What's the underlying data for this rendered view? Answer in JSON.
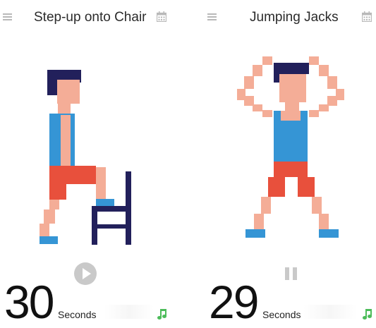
{
  "screens": [
    {
      "title": "Step-up onto Chair",
      "count": "30",
      "unit": "Seconds",
      "control": "play-icon"
    },
    {
      "title": "Jumping Jacks",
      "count": "29",
      "unit": "Seconds",
      "control": "pause-icon"
    }
  ],
  "colors": {
    "skin": "#f4ad97",
    "hair": "#22205b",
    "shirt": "#3595d5",
    "shorts": "#e8503c",
    "shoes": "#3595d5",
    "chair": "#22205b",
    "icon_gray": "#b9b9b9",
    "music_green": "#4cbc5a"
  }
}
